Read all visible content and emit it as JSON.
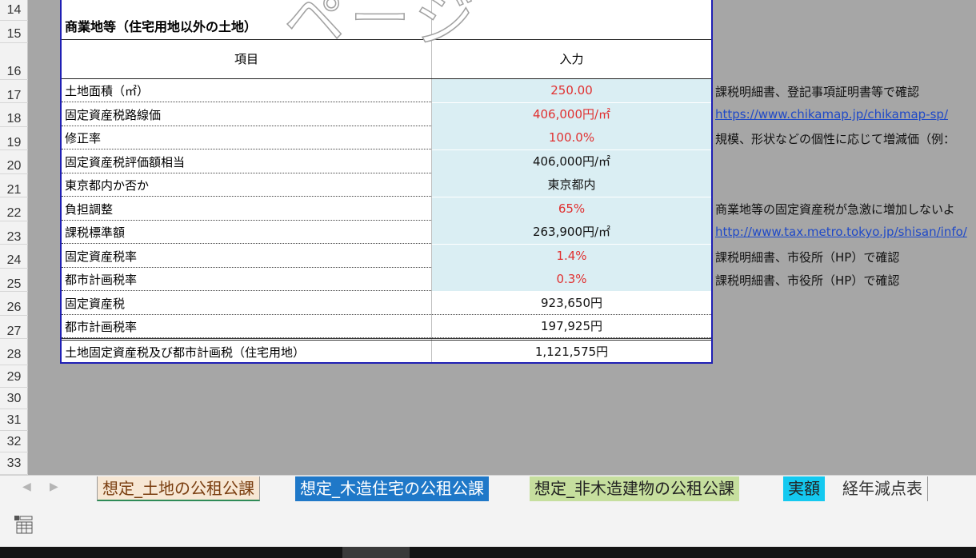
{
  "row_numbers": [
    "14",
    "15",
    "16",
    "17",
    "18",
    "19",
    "20",
    "21",
    "22",
    "23",
    "24",
    "25",
    "26",
    "27",
    "28",
    "29",
    "30",
    "31",
    "32",
    "33"
  ],
  "watermark": "ページ",
  "section_title": "商業地等（住宅用地以外の土地）",
  "table_header": {
    "item": "項目",
    "input": "入力"
  },
  "rows": [
    {
      "label": "土地面積（㎡）",
      "value": "250.00"
    },
    {
      "label": "固定資産税路線価",
      "value": "406,000円/㎡"
    },
    {
      "label": "修正率",
      "value": "100.0%"
    },
    {
      "label": "固定資産税評価額相当",
      "value": "406,000円/㎡"
    },
    {
      "label": "東京都内か否か",
      "value": "東京都内"
    },
    {
      "label": "負担調整",
      "value": "65%"
    },
    {
      "label": "課税標準額",
      "value": "263,900円/㎡"
    },
    {
      "label": "固定資産税率",
      "value": "1.4%"
    },
    {
      "label": "都市計画税率",
      "value": "0.3%"
    },
    {
      "label": "固定資産税",
      "value": "923,650円"
    },
    {
      "label": "都市計画税率",
      "value": "197,925円"
    },
    {
      "label": "土地固定資産税及び都市計画税（住宅用地）",
      "value": "1,121,575円"
    }
  ],
  "notes": [
    "課税明細書、登記事項証明書等で確認",
    "https://www.chikamap.jp/chikamap-sp/",
    "規模、形状などの個性に応じて増減価（例：",
    "商業地等の固定資産税が急激に増加しないよ",
    "http://www.tax.metro.tokyo.jp/shisan/info/",
    "課税明細書、市役所（HP）で確認",
    "課税明細書、市役所（HP）で確認"
  ],
  "tabs": [
    "想定_土地の公租公課",
    "想定_木造住宅の公租公課",
    "想定_非木造建物の公租公課",
    "実額",
    "経年減点表"
  ],
  "colors": {
    "red_value": "#e03030",
    "input_shade": "#daeef3",
    "link": "#1f49c7",
    "table_border": "#1f1fb4"
  }
}
